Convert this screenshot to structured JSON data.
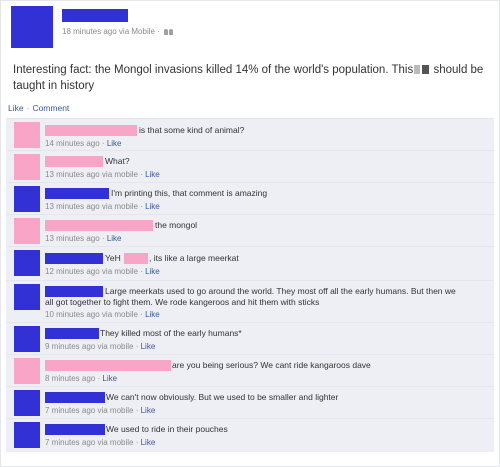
{
  "post": {
    "meta": "18 minutes ago via Mobile",
    "text_part1": "Interesting fact: the Mongol invasions killed 14% of the world's population. This",
    "text_part2": "should be taught in history"
  },
  "actions": {
    "like": "Like",
    "comment": "Comment"
  },
  "colors": {
    "redact_blue": "#3131d6",
    "redact_pink": "#f9a5c8",
    "link": "#3b5998",
    "comment_bg": "#edeff4"
  },
  "comments": [
    {
      "text": "is that some kind of animal?",
      "meta": "14 minutes ago",
      "like": "Like"
    },
    {
      "text": "What?",
      "meta": "13 minutes ago via mobile",
      "like": "Like"
    },
    {
      "text": "I'm printing this, that comment is amazing",
      "meta": "13 minutes ago via mobile",
      "like": "Like"
    },
    {
      "text": "the mongol",
      "meta": "13 minutes ago",
      "like": "Like"
    },
    {
      "text_a": "YeH",
      "text_b": ", its like a large meerkat",
      "meta": "12 minutes ago via mobile",
      "like": "Like"
    },
    {
      "text_line1": "Large meerkats used to go around the world. They most off all the early humans. But then we",
      "text_line2": "all got together to fight them. We rode kangeroos and hit them with sticks",
      "meta": "10 minutes ago via mobile",
      "like": "Like"
    },
    {
      "text": "They killed most of the early humans*",
      "meta": "9 minutes ago via mobile",
      "like": "Like"
    },
    {
      "text": "are you being serious? We cant ride kangaroos dave",
      "meta": "8 minutes ago",
      "like": "Like"
    },
    {
      "text": "We can't now obviously. But we used to be smaller and lighter",
      "meta": "7 minutes ago via mobile",
      "like": "Like"
    },
    {
      "text": "We used to ride in their pouches",
      "meta": "7 minutes ago via mobile",
      "like": "Like"
    }
  ]
}
